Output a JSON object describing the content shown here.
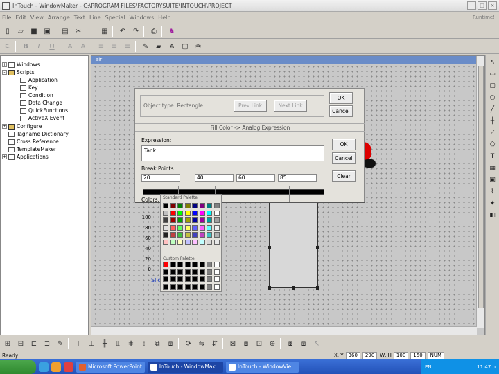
{
  "window": {
    "title": "InTouch - WindowMaker - C:\\PROGRAM FILES\\FACTORYSUITE\\INTOUCH\\PROJECT",
    "buttons": [
      "_",
      "□",
      "×"
    ]
  },
  "menu": {
    "items": [
      "File",
      "Edit",
      "View",
      "Arrange",
      "Text",
      "Line",
      "Special",
      "Windows",
      "Help"
    ],
    "runtime": "Runtime!"
  },
  "tree": {
    "items": [
      {
        "label": "Windows",
        "level": 0,
        "expander": "+"
      },
      {
        "label": "Scripts",
        "level": 0,
        "expander": "-"
      },
      {
        "label": "Application",
        "level": 1
      },
      {
        "label": "Key",
        "level": 1
      },
      {
        "label": "Condition",
        "level": 1
      },
      {
        "label": "Data Change",
        "level": 1
      },
      {
        "label": "QuickFunctions",
        "level": 1
      },
      {
        "label": "ActiveX Event",
        "level": 1
      },
      {
        "label": "Configure",
        "level": 0,
        "expander": "+"
      },
      {
        "label": "Tagname Dictionary",
        "level": 0
      },
      {
        "label": "Cross Reference",
        "level": 0
      },
      {
        "label": "TemplateMaker",
        "level": 0
      },
      {
        "label": "Applications",
        "level": 0,
        "expander": "+"
      }
    ]
  },
  "canvas": {
    "window_name": "air"
  },
  "dialog": {
    "object_type_label": "Object type:",
    "object_type_value": "Rectangle",
    "prev_link": "Prev Link",
    "next_link": "Next Link",
    "ok": "OK",
    "cancel": "Cancel",
    "subtitle": "Fill Color -> Analog Expression",
    "expression_label": "Expression:",
    "expression_value": "Tank",
    "ok2": "OK",
    "cancel2": "Cancel",
    "clear": "Clear",
    "breakpoints_label": "Break Points:",
    "breakpoints": [
      "20",
      "40",
      "60",
      "85"
    ],
    "colors_label": "Colors:"
  },
  "color_popup": {
    "standard_label": "Standard Palette",
    "custom_label": "Custom Palette",
    "standard_colors": [
      "#000000",
      "#800000",
      "#008000",
      "#808000",
      "#000080",
      "#800080",
      "#008080",
      "#808080",
      "#c0c0c0",
      "#ff0000",
      "#00ff00",
      "#ffff00",
      "#0000ff",
      "#ff00ff",
      "#00ffff",
      "#ffffff",
      "#404040",
      "#a00000",
      "#00a000",
      "#a0a000",
      "#0000a0",
      "#a000a0",
      "#00a0a0",
      "#a0a0a0",
      "#e0e0e0",
      "#ff6060",
      "#60ff60",
      "#ffff60",
      "#6060ff",
      "#ff60ff",
      "#60ffff",
      "#f0f0f0",
      "#202020",
      "#c04040",
      "#40c040",
      "#c0c040",
      "#4040c0",
      "#c040c0",
      "#40c0c0",
      "#b0b0b0",
      "#ffc0c0",
      "#c0ffc0",
      "#ffffc0",
      "#c0c0ff",
      "#ffc0ff",
      "#c0ffff",
      "#d8d8d8",
      "#e8e8e8"
    ],
    "custom_colors": [
      "#ff0000",
      "#000000",
      "#000000",
      "#000000",
      "#000000",
      "#000000",
      "#808080",
      "#ffffff",
      "#000000",
      "#000000",
      "#000000",
      "#000000",
      "#000000",
      "#000000",
      "#808080",
      "#ffffff",
      "#000000",
      "#000000",
      "#000000",
      "#000000",
      "#000000",
      "#000000",
      "#808080",
      "#ffffff",
      "#000000",
      "#000000",
      "#000000",
      "#000000",
      "#000000",
      "#000000",
      "#808080",
      "#ffffff"
    ]
  },
  "scale": {
    "labels": [
      "100",
      "80",
      "60",
      "40",
      "20",
      "0"
    ],
    "slider_label": "Slid"
  },
  "status": {
    "ready": "Ready",
    "xy_label": "X, Y",
    "x": "360",
    "y": "290",
    "wh_label": "W, H",
    "w": "100",
    "h": "150",
    "num": "NUM"
  },
  "taskbar": {
    "buttons": [
      {
        "label": "Microsoft PowerPoint",
        "active": false
      },
      {
        "label": "InTouch - WindowMak...",
        "active": true
      },
      {
        "label": "InTouch - WindowVie...",
        "active": false
      }
    ],
    "lang": "EN",
    "clock": "11:47 p"
  },
  "icons": {
    "toolbar1": [
      "new-icon",
      "open-icon",
      "save-icon",
      "save-all-icon",
      "print-icon",
      "cut-icon",
      "copy-icon",
      "paste-icon",
      "undo-icon",
      "redo-icon",
      "print-preview-icon",
      "wizard-icon"
    ],
    "toolbar2": [
      "align-icon",
      "bold-icon",
      "italic-icon",
      "underline-icon",
      "font-icon",
      "font-size-icon",
      "text-left-icon",
      "text-center-icon",
      "text-right-icon",
      "line-color-icon",
      "fill-color-icon",
      "text-color-icon",
      "window-color-icon",
      "paint-icon"
    ],
    "palette": [
      "select-arrow-icon",
      "rectangle-icon",
      "rounded-rect-icon",
      "ellipse-icon",
      "line-icon",
      "hv-line-icon",
      "polyline-icon",
      "polygon-icon",
      "text-tool-icon",
      "bitmap-icon",
      "button-tool-icon",
      "trend-icon",
      "wizard-tool-icon",
      "activex-icon"
    ]
  }
}
